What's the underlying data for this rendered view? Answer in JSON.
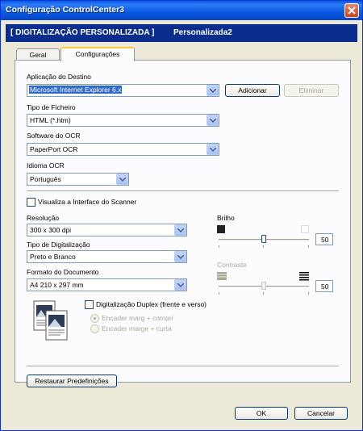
{
  "window": {
    "title": "Configuração ControlCenter3",
    "close_label": "close"
  },
  "header": {
    "section": "[ DIGITALIZAÇÃO PERSONALIZADA ]",
    "profile": "Personalizada2"
  },
  "tabs": [
    {
      "label": "Geral"
    },
    {
      "label": "Configurações"
    }
  ],
  "target_app": {
    "label": "Aplicação do Destino",
    "value": "Microsoft Internet Explorer 6.x",
    "add_label": "Adicionar",
    "remove_label": "Eliminar"
  },
  "file_type": {
    "label": "Tipo de Ficheiro",
    "value": "HTML (*.htm)"
  },
  "ocr_software": {
    "label": "Software do OCR",
    "value": "PaperPort OCR"
  },
  "ocr_language": {
    "label": "Idioma OCR",
    "value": "Português"
  },
  "scanner_ui": {
    "label": "Visualiza a Interface do Scanner",
    "checked": false
  },
  "resolution": {
    "label": "Resolução",
    "value": "300 x 300 dpi"
  },
  "scan_type": {
    "label": "Tipo de Digitalização",
    "value": "Preto e Branco"
  },
  "doc_size": {
    "label": "Formato do Documento",
    "value": "A4 210 x 297 mm"
  },
  "brightness": {
    "label": "Brilho",
    "value": "50",
    "level": 0.5
  },
  "contrast": {
    "label": "Contraste",
    "value": "50",
    "level": 0.5,
    "enabled": false
  },
  "duplex": {
    "label": "Digitalização Duplex (frente e verso)",
    "checked": false,
    "options": [
      "Encader marg + compri",
      "Encader marge + curta"
    ]
  },
  "restore_label": "Restaurar Predefinições",
  "ok_label": "OK",
  "cancel_label": "Cancelar",
  "colors": {
    "titlebar": "#0a5ae0",
    "header": "#0b2e8e",
    "selection": "#316ac5",
    "tab_highlight": "#ffc83c"
  }
}
